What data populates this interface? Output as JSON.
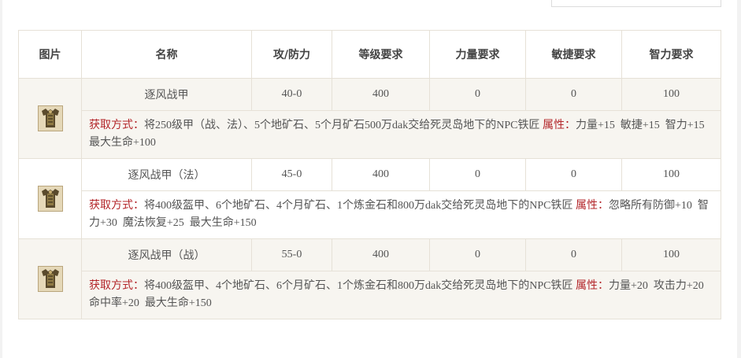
{
  "table": {
    "headers": [
      "图片",
      "名称",
      "攻/防力",
      "等级要求",
      "力量要求",
      "敏捷要求",
      "智力要求"
    ],
    "rows": [
      {
        "icon": "armor-icon",
        "name": "逐风战甲",
        "atk_def": "40-0",
        "level": "400",
        "str": "0",
        "dex": "0",
        "int": "100",
        "obtain_label": "获取方式：",
        "obtain_text": "将250级甲（战、法）、5个地矿石、5个月矿石500万dak交给死灵岛地下的NPC铁匠",
        "attr_label": "属性：",
        "attr_text": "力量+15  敏捷+15  智力+15  最大生命+100"
      },
      {
        "icon": "armor-icon",
        "name": "逐风战甲（法）",
        "atk_def": "45-0",
        "level": "400",
        "str": "0",
        "dex": "0",
        "int": "100",
        "obtain_label": "获取方式：",
        "obtain_text": "将400级盔甲、6个地矿石、4个月矿石、1个炼金石和800万dak交给死灵岛地下的NPC铁匠",
        "attr_label": "属性：",
        "attr_text": "忽略所有防御+10  智力+30  魔法恢复+25  最大生命+150"
      },
      {
        "icon": "armor-icon",
        "name": "逐风战甲（战）",
        "atk_def": "55-0",
        "level": "400",
        "str": "0",
        "dex": "0",
        "int": "100",
        "obtain_label": "获取方式：",
        "obtain_text": "将400级盔甲、4个地矿石、6个月矿石、1个炼金石和800万dak交给死灵岛地下的NPC铁匠",
        "attr_label": "属性：",
        "attr_text": "力量+20  攻击力+20  命中率+20  最大生命+150"
      }
    ]
  },
  "colors": {
    "accent_label": "#b3262a",
    "row_bg": "#f7f5f0",
    "border": "#e6e1d7"
  }
}
